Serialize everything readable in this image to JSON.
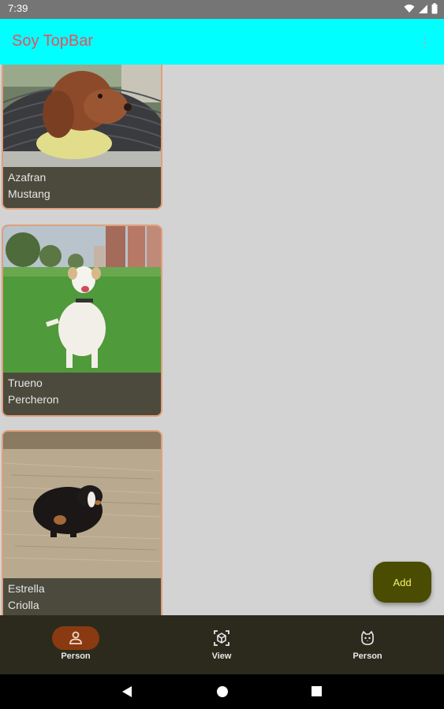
{
  "status_bar": {
    "time": "7:39"
  },
  "top_bar": {
    "title": "Soy TopBar"
  },
  "dogs": [
    {
      "name": "Azafran",
      "breed": "Mustang"
    },
    {
      "name": "Trueno",
      "breed": "Percheron"
    },
    {
      "name": "Estrella",
      "breed": "Criolla"
    }
  ],
  "fab": {
    "label": "Add"
  },
  "bottom_nav": [
    {
      "label": "Person",
      "icon": "person-icon",
      "active": true
    },
    {
      "label": "View",
      "icon": "view-in-ar-icon",
      "active": false
    },
    {
      "label": "Person",
      "icon": "pets-face-icon",
      "active": false
    }
  ],
  "colors": {
    "top_bar": "#00ffff",
    "title": "#e8505b",
    "card": "#4b4a3d",
    "card_border": "#e0a07a",
    "fab": "#4a4c02",
    "fab_text": "#f4f46a",
    "bottom_nav": "#2c2a1d",
    "nav_active": "#8a3a10"
  }
}
